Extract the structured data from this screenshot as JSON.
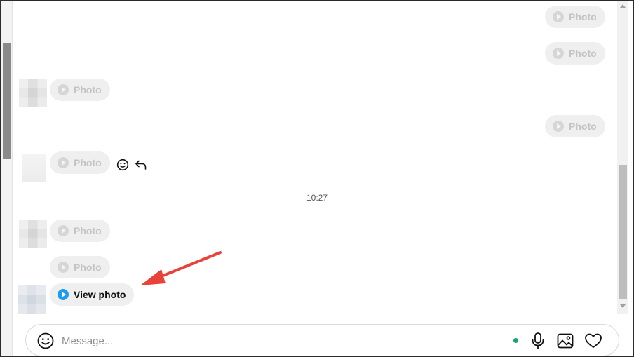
{
  "thread": {
    "messages": [
      {
        "sender": "outgoing",
        "label": "Photo"
      },
      {
        "sender": "outgoing",
        "label": "Photo"
      },
      {
        "sender": "incoming",
        "label": "Photo"
      },
      {
        "sender": "outgoing",
        "label": "Photo"
      },
      {
        "sender": "incoming",
        "label": "Photo"
      },
      {
        "sender": "incoming",
        "label": "Photo"
      },
      {
        "sender": "incoming",
        "label": "Photo"
      },
      {
        "sender": "incoming",
        "label": "View photo"
      }
    ],
    "timestamp": "10:27",
    "hover_actions": [
      "smiley-icon",
      "reply-icon"
    ]
  },
  "composer": {
    "placeholder": "Message...",
    "value": "",
    "icons": [
      "emoji-icon",
      "microphone-icon",
      "image-icon",
      "heart-icon"
    ]
  },
  "colors": {
    "accent": "#1d9bf0",
    "annotation_arrow": "#e8423b",
    "bubble_background": "#efefef",
    "online_dot": "#1aa36f"
  }
}
